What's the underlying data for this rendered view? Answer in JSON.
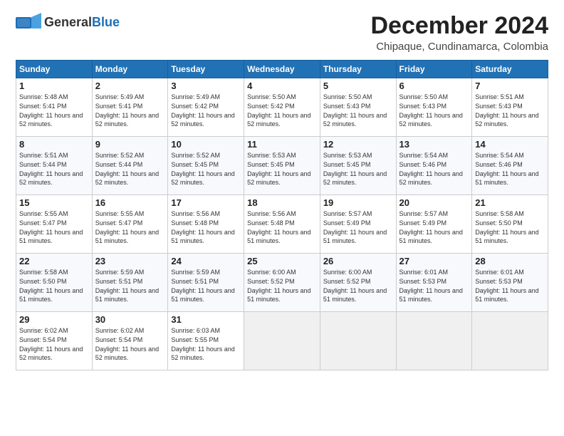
{
  "header": {
    "logo_general": "General",
    "logo_blue": "Blue",
    "month_title": "December 2024",
    "location": "Chipaque, Cundinamarca, Colombia"
  },
  "weekdays": [
    "Sunday",
    "Monday",
    "Tuesday",
    "Wednesday",
    "Thursday",
    "Friday",
    "Saturday"
  ],
  "weeks": [
    [
      {
        "day": "1",
        "sunrise": "5:48 AM",
        "sunset": "5:41 PM",
        "daylight": "11 hours and 52 minutes."
      },
      {
        "day": "2",
        "sunrise": "5:49 AM",
        "sunset": "5:41 PM",
        "daylight": "11 hours and 52 minutes."
      },
      {
        "day": "3",
        "sunrise": "5:49 AM",
        "sunset": "5:42 PM",
        "daylight": "11 hours and 52 minutes."
      },
      {
        "day": "4",
        "sunrise": "5:50 AM",
        "sunset": "5:42 PM",
        "daylight": "11 hours and 52 minutes."
      },
      {
        "day": "5",
        "sunrise": "5:50 AM",
        "sunset": "5:43 PM",
        "daylight": "11 hours and 52 minutes."
      },
      {
        "day": "6",
        "sunrise": "5:50 AM",
        "sunset": "5:43 PM",
        "daylight": "11 hours and 52 minutes."
      },
      {
        "day": "7",
        "sunrise": "5:51 AM",
        "sunset": "5:43 PM",
        "daylight": "11 hours and 52 minutes."
      }
    ],
    [
      {
        "day": "8",
        "sunrise": "5:51 AM",
        "sunset": "5:44 PM",
        "daylight": "11 hours and 52 minutes."
      },
      {
        "day": "9",
        "sunrise": "5:52 AM",
        "sunset": "5:44 PM",
        "daylight": "11 hours and 52 minutes."
      },
      {
        "day": "10",
        "sunrise": "5:52 AM",
        "sunset": "5:45 PM",
        "daylight": "11 hours and 52 minutes."
      },
      {
        "day": "11",
        "sunrise": "5:53 AM",
        "sunset": "5:45 PM",
        "daylight": "11 hours and 52 minutes."
      },
      {
        "day": "12",
        "sunrise": "5:53 AM",
        "sunset": "5:45 PM",
        "daylight": "11 hours and 52 minutes."
      },
      {
        "day": "13",
        "sunrise": "5:54 AM",
        "sunset": "5:46 PM",
        "daylight": "11 hours and 52 minutes."
      },
      {
        "day": "14",
        "sunrise": "5:54 AM",
        "sunset": "5:46 PM",
        "daylight": "11 hours and 51 minutes."
      }
    ],
    [
      {
        "day": "15",
        "sunrise": "5:55 AM",
        "sunset": "5:47 PM",
        "daylight": "11 hours and 51 minutes."
      },
      {
        "day": "16",
        "sunrise": "5:55 AM",
        "sunset": "5:47 PM",
        "daylight": "11 hours and 51 minutes."
      },
      {
        "day": "17",
        "sunrise": "5:56 AM",
        "sunset": "5:48 PM",
        "daylight": "11 hours and 51 minutes."
      },
      {
        "day": "18",
        "sunrise": "5:56 AM",
        "sunset": "5:48 PM",
        "daylight": "11 hours and 51 minutes."
      },
      {
        "day": "19",
        "sunrise": "5:57 AM",
        "sunset": "5:49 PM",
        "daylight": "11 hours and 51 minutes."
      },
      {
        "day": "20",
        "sunrise": "5:57 AM",
        "sunset": "5:49 PM",
        "daylight": "11 hours and 51 minutes."
      },
      {
        "day": "21",
        "sunrise": "5:58 AM",
        "sunset": "5:50 PM",
        "daylight": "11 hours and 51 minutes."
      }
    ],
    [
      {
        "day": "22",
        "sunrise": "5:58 AM",
        "sunset": "5:50 PM",
        "daylight": "11 hours and 51 minutes."
      },
      {
        "day": "23",
        "sunrise": "5:59 AM",
        "sunset": "5:51 PM",
        "daylight": "11 hours and 51 minutes."
      },
      {
        "day": "24",
        "sunrise": "5:59 AM",
        "sunset": "5:51 PM",
        "daylight": "11 hours and 51 minutes."
      },
      {
        "day": "25",
        "sunrise": "6:00 AM",
        "sunset": "5:52 PM",
        "daylight": "11 hours and 51 minutes."
      },
      {
        "day": "26",
        "sunrise": "6:00 AM",
        "sunset": "5:52 PM",
        "daylight": "11 hours and 51 minutes."
      },
      {
        "day": "27",
        "sunrise": "6:01 AM",
        "sunset": "5:53 PM",
        "daylight": "11 hours and 51 minutes."
      },
      {
        "day": "28",
        "sunrise": "6:01 AM",
        "sunset": "5:53 PM",
        "daylight": "11 hours and 51 minutes."
      }
    ],
    [
      {
        "day": "29",
        "sunrise": "6:02 AM",
        "sunset": "5:54 PM",
        "daylight": "11 hours and 52 minutes."
      },
      {
        "day": "30",
        "sunrise": "6:02 AM",
        "sunset": "5:54 PM",
        "daylight": "11 hours and 52 minutes."
      },
      {
        "day": "31",
        "sunrise": "6:03 AM",
        "sunset": "5:55 PM",
        "daylight": "11 hours and 52 minutes."
      },
      null,
      null,
      null,
      null
    ]
  ]
}
